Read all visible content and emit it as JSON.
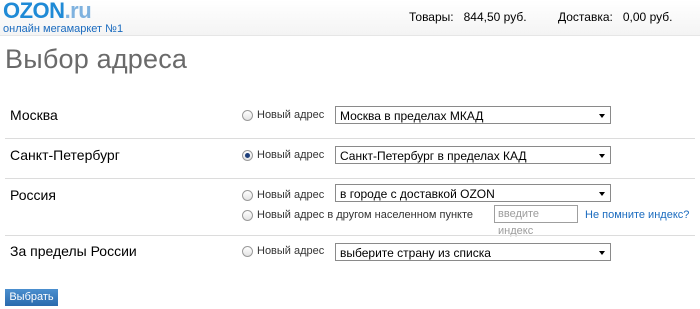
{
  "header": {
    "logo_main": "OZON",
    "logo_suffix": ".ru",
    "logo_tagline": "онлайн мегамаркет №1",
    "goods_label": "Товары:",
    "goods_value": "844,50 руб.",
    "delivery_label": "Доставка:",
    "delivery_value": "0,00 руб."
  },
  "page_title": "Выбор адреса",
  "regions": [
    {
      "city": "Москва",
      "new_address_label": "Новый адрес",
      "selected": false,
      "select_value": "Москва в пределах МКАД"
    },
    {
      "city": "Санкт-Петербург",
      "new_address_label": "Новый адрес",
      "selected": true,
      "select_value": "Санкт-Петербург в пределах КАД"
    },
    {
      "city": "Россия",
      "new_address_label": "Новый адрес",
      "selected": false,
      "select_value": "в городе с доставкой OZON",
      "other_label": "Новый адрес в другом населенном пункте",
      "index_placeholder": "введите",
      "index_placeholder_tail": "индекс",
      "index_help_link": "Не помните индекс?"
    },
    {
      "city": "За пределы России",
      "new_address_label": "Новый адрес",
      "selected": false,
      "select_value": "выберите страну из списка"
    }
  ],
  "submit_label": "Выбрать"
}
